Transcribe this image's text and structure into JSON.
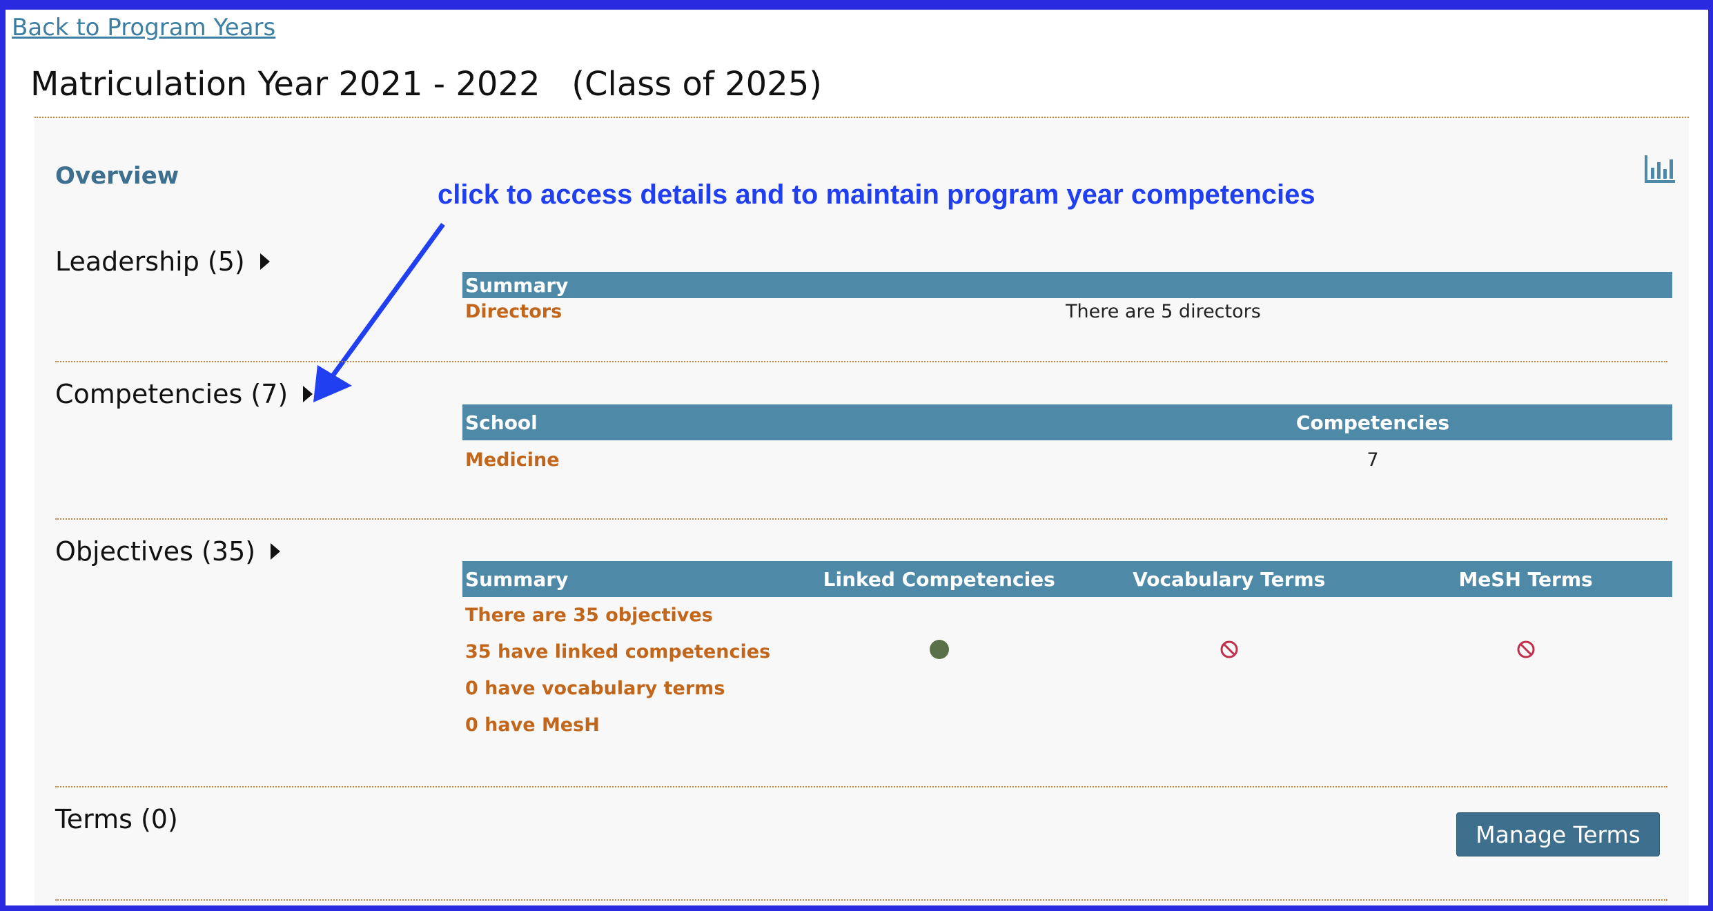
{
  "nav": {
    "back_label": "Back to Program Years"
  },
  "header": {
    "title": "Matriculation Year 2021 - 2022   (Class of 2025)"
  },
  "overview": {
    "label": "Overview",
    "chart_icon": "bar-chart-icon"
  },
  "annotation": {
    "text": "click to access details and to maintain program year competencies"
  },
  "leadership": {
    "title": "Leadership (5)",
    "header": "Summary",
    "row_label": "Directors",
    "row_value": "There are 5 directors"
  },
  "competencies": {
    "title": "Competencies (7)",
    "headers": [
      "School",
      "Competencies"
    ],
    "row": {
      "school": "Medicine",
      "count": "7"
    }
  },
  "objectives": {
    "title": "Objectives (35)",
    "headers": [
      "Summary",
      "Linked Competencies",
      "Vocabulary Terms",
      "MeSH Terms"
    ],
    "rows": [
      "There are 35 objectives",
      "35 have linked competencies",
      "0 have vocabulary terms",
      "0 have MesH"
    ],
    "status": {
      "linked_competencies": "filled-circle-icon",
      "vocabulary_terms": "prohibited-icon",
      "mesh_terms": "prohibited-icon"
    }
  },
  "terms": {
    "title": "Terms (0)",
    "button_label": "Manage Terms"
  },
  "colors": {
    "frame": "#2a2ae0",
    "table_header": "#4e8aa8",
    "link_orange": "#c1661b",
    "button": "#3e6f8c",
    "annotation": "#1f3ff0",
    "status_ok": "#5a7048",
    "status_none": "#c0304a"
  }
}
